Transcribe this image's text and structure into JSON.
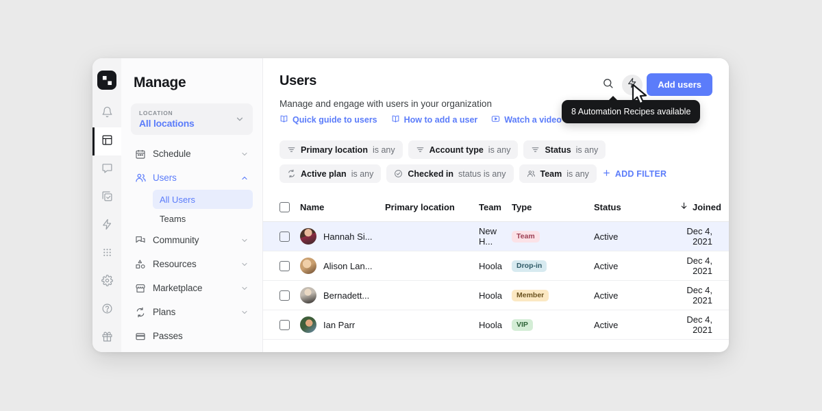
{
  "rail": {
    "logo": "app-logo",
    "items": [
      {
        "name": "notifications",
        "icon": "bell-icon",
        "active": false
      },
      {
        "name": "dashboard",
        "icon": "layout-dashboard-icon",
        "active": true
      },
      {
        "name": "messages",
        "icon": "chat-bubble-icon",
        "active": false
      },
      {
        "name": "tasks",
        "icon": "checklist-icon",
        "active": false
      },
      {
        "name": "automations",
        "icon": "lightning-bolt-icon",
        "active": false
      },
      {
        "name": "apps",
        "icon": "grid-dots-icon",
        "active": false
      },
      {
        "name": "settings",
        "icon": "gear-icon",
        "active": false
      },
      {
        "name": "help",
        "icon": "question-circle-icon",
        "active": false
      },
      {
        "name": "rewards",
        "icon": "gift-icon",
        "active": false
      }
    ]
  },
  "sidebar": {
    "title": "Manage",
    "location": {
      "label": "LOCATION",
      "value": "All locations",
      "chevron": "chevron-down-icon"
    },
    "items": [
      {
        "label": "Schedule",
        "icon": "calendar-icon",
        "chevron": "chevron-down-icon",
        "selected": false,
        "expanded": false
      },
      {
        "label": "Users",
        "icon": "users-icon",
        "chevron": "chevron-up-icon",
        "selected": true,
        "expanded": true
      },
      {
        "label": "Community",
        "icon": "community-icon",
        "chevron": "chevron-down-icon",
        "selected": false,
        "expanded": false
      },
      {
        "label": "Resources",
        "icon": "shapes-icon",
        "chevron": "chevron-down-icon",
        "selected": false,
        "expanded": false
      },
      {
        "label": "Marketplace",
        "icon": "storefront-icon",
        "chevron": "chevron-down-icon",
        "selected": false,
        "expanded": false
      },
      {
        "label": "Plans",
        "icon": "recurring-icon",
        "chevron": "chevron-down-icon",
        "selected": false,
        "expanded": false
      },
      {
        "label": "Passes",
        "icon": "card-icon",
        "chevron": "",
        "selected": false,
        "expanded": false
      }
    ],
    "subitems": [
      {
        "label": "All Users",
        "active": true
      },
      {
        "label": "Teams",
        "active": false
      }
    ]
  },
  "header": {
    "title": "Users",
    "subtitle": "Manage and engage with users in your organization",
    "links": [
      {
        "label": "Quick guide to users",
        "icon": "book-icon"
      },
      {
        "label": "How to add a user",
        "icon": "book-icon"
      },
      {
        "label": "Watch a video",
        "icon": "play-video-icon"
      }
    ],
    "search_icon": "search-icon",
    "automation_icon": "lightning-bolt-icon",
    "add_users_label": "Add users",
    "accent_color": "#5b7cfa"
  },
  "tooltip": {
    "text": "8 Automation Recipes available",
    "bg_color": "#17181a"
  },
  "filters": {
    "chips": [
      {
        "icon": "filter-lines-icon",
        "label": "Primary location",
        "suffix": "is any"
      },
      {
        "icon": "filter-lines-icon",
        "label": "Account type",
        "suffix": "is any"
      },
      {
        "icon": "filter-lines-icon",
        "label": "Status",
        "suffix": "is any"
      },
      {
        "icon": "recurring-icon",
        "label": "Active plan",
        "suffix": "is any"
      },
      {
        "icon": "check-circle-icon",
        "label": "Checked in",
        "suffix": "status is any"
      },
      {
        "icon": "users-icon",
        "label": "Team",
        "suffix": "is any"
      }
    ],
    "add_filter_label": "ADD FILTER",
    "add_filter_icon": "plus-icon"
  },
  "table": {
    "columns": [
      "Name",
      "Primary location",
      "Team",
      "Type",
      "Status",
      "Joined"
    ],
    "sort_column": "Joined",
    "sort_icon": "arrow-down-icon",
    "rows": [
      {
        "name": "Hannah Si...",
        "location": "",
        "team": "New H...",
        "type": "Team",
        "type_bg": "#fbe2e7",
        "type_fg": "#9c4054",
        "status": "Active",
        "joined": "Dec 4, 2021",
        "highlight": true,
        "avatar_a": "#7a4a3c",
        "avatar_b": "#3a2b2b"
      },
      {
        "name": "Alison Lan...",
        "location": "",
        "team": "Hoola",
        "type": "Drop-in",
        "type_bg": "#d7eaf0",
        "type_fg": "#2e5a66",
        "status": "Active",
        "joined": "Dec 4, 2021",
        "highlight": false,
        "avatar_a": "#c49a6c",
        "avatar_b": "#6b4a2f"
      },
      {
        "name": "Bernadett...",
        "location": "",
        "team": "Hoola",
        "type": "Member",
        "type_bg": "#fbe8c3",
        "type_fg": "#6b5320",
        "status": "Active",
        "joined": "Dec 4, 2021",
        "highlight": false,
        "avatar_a": "#b9b4ad",
        "avatar_b": "#2f2c2a"
      },
      {
        "name": "Ian Parr",
        "location": "",
        "team": "Hoola",
        "type": "VIP",
        "type_bg": "#d4edd6",
        "type_fg": "#2d6336",
        "status": "Active",
        "joined": "Dec 4, 2021",
        "highlight": false,
        "avatar_a": "#3e5e3a",
        "avatar_b": "#6e8fae"
      }
    ]
  }
}
